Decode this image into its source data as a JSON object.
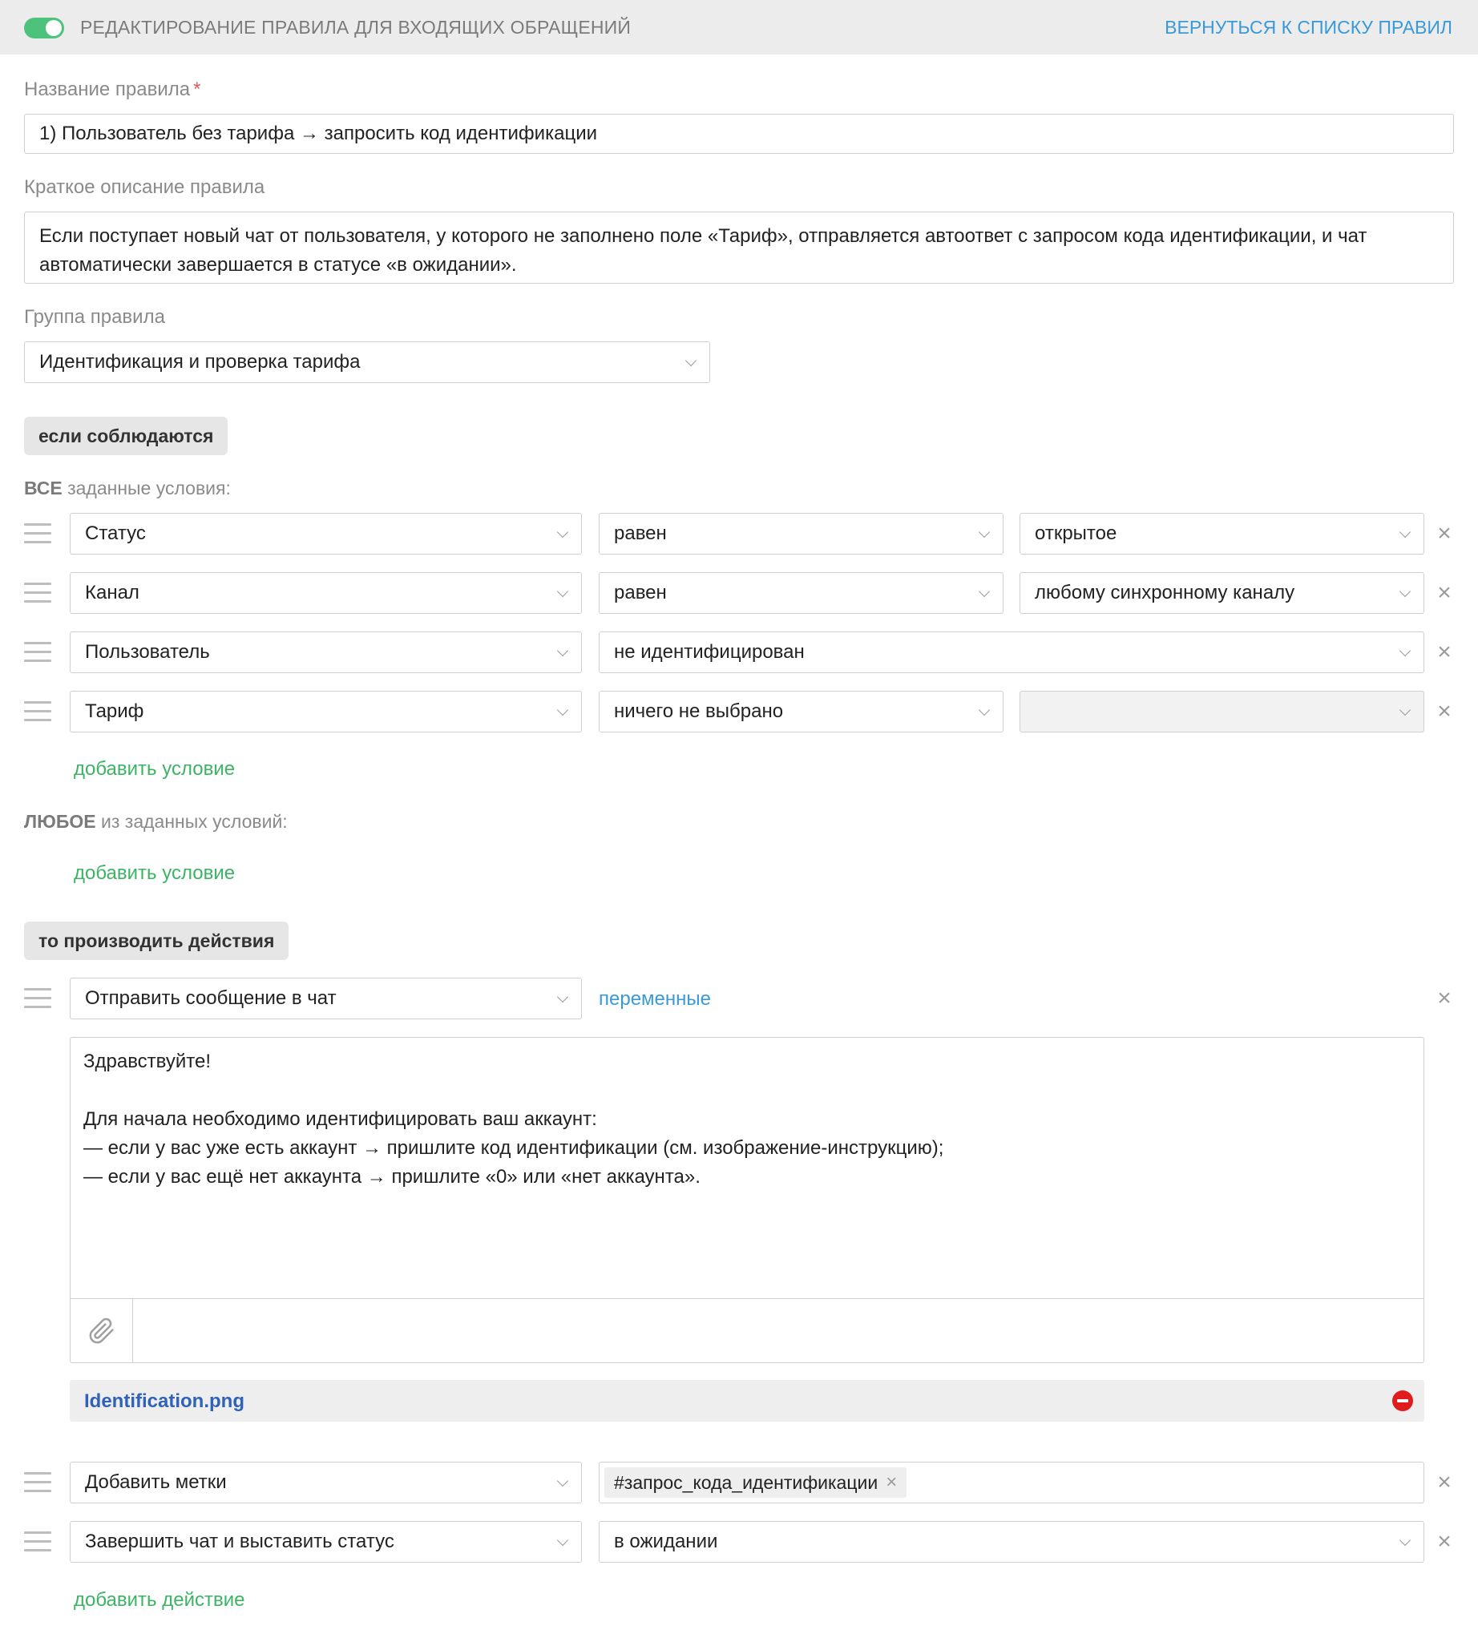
{
  "header": {
    "title": "РЕДАКТИРОВАНИЕ ПРАВИЛА ДЛЯ ВХОДЯЩИХ ОБРАЩЕНИЙ",
    "back_link": "ВЕРНУТЬСЯ К СПИСКУ ПРАВИЛ",
    "toggle_on": true
  },
  "form": {
    "name_label": "Название правила",
    "required_mark": "*",
    "name_value": "1) Пользователь без тарифа → запросить код идентификации",
    "desc_label": "Краткое описание правила",
    "desc_value": "Если поступает новый чат от пользователя, у которого не заполнено поле «Тариф», отправляется автоответ с запросом кода идентификации, и чат автоматически завершается в статусе «в ожидании».",
    "group_label": "Группа правила",
    "group_value": "Идентификация и проверка тарифа"
  },
  "conditions": {
    "if_label": "если соблюдаются",
    "all_bold": "ВСЕ",
    "all_rest": " заданные условия:",
    "all_rows": [
      {
        "field": "Статус",
        "operator": "равен",
        "value": "открытое"
      },
      {
        "field": "Канал",
        "operator": "равен",
        "value": "любому синхронному каналу"
      },
      {
        "field": "Пользователь",
        "operator": "не идентифицирован"
      },
      {
        "field": "Тариф",
        "operator": "ничего не выбрано",
        "value": ""
      }
    ],
    "add_condition": "добавить условие",
    "any_bold": "ЛЮБОЕ",
    "any_rest": " из заданных условий:"
  },
  "actions": {
    "then_label": "то производить действия",
    "send_message": "Отправить сообщение в чат",
    "variables_link": "переменные",
    "message_lines": [
      "Здравствуйте!",
      "",
      "Для начала необходимо идентифицировать ваш аккаунт:",
      "— если у вас уже есть аккаунт → пришлите код идентификации (см. изображение-инструкцию);",
      "— если у вас ещё нет аккаунта → пришлите «0» или «нет аккаунта»."
    ],
    "attachment": "Identification.png",
    "add_tags": "Добавить метки",
    "tag_value": "#запрос_кода_идентификации",
    "close_chat": "Завершить чат и выставить статус",
    "close_status": "в ожидании",
    "add_action": "добавить действие"
  },
  "icons": {
    "remove": "close-icon",
    "drag": "drag-handle-icon",
    "attach": "paperclip-icon",
    "dropdown": "chevron-down-icon",
    "file_remove": "minus-circle-icon"
  },
  "colors": {
    "accent_green": "#3cb464",
    "toggle_green": "#4cc27b",
    "link_blue": "#3a9ad9",
    "file_blue": "#2f62b8",
    "danger_red": "#e01c1c"
  }
}
